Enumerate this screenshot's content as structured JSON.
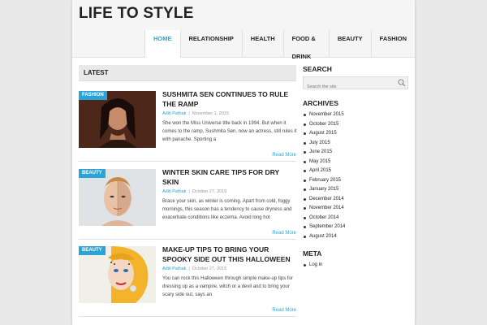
{
  "site": {
    "title": "LIFE TO STYLE"
  },
  "nav": [
    {
      "label": "HOME",
      "active": true
    },
    {
      "label": "RELATIONSHIP"
    },
    {
      "label": "HEALTH"
    },
    {
      "label": "FOOD & DRINK"
    },
    {
      "label": "BEAUTY"
    },
    {
      "label": "FASHION"
    }
  ],
  "main": {
    "section_title": "LATEST",
    "posts": [
      {
        "category": "FASHION",
        "title": "SUSHMITA SEN CONTINUES TO RULE THE RAMP",
        "author": "Aditi Pathak",
        "date": "November 1, 2015",
        "excerpt": "She won the Miss Universe title back in 1994. But when it comes to the ramp, Sushmita Sen, now an actress, still rules it with panache. Sporting a",
        "read_more": "Read More"
      },
      {
        "category": "BEAUTY",
        "title": "WINTER SKIN CARE TIPS FOR DRY SKIN",
        "author": "Aditi Pathak",
        "date": "October 27, 2015",
        "excerpt": "Brace your skin, as winter is coming. Apart from cold, foggy mornings, this season has a tendency to cause dryness and exacerbate conditions like eczema. Avoid long hot",
        "read_more": "Read More"
      },
      {
        "category": "BEAUTY",
        "title": "MAKE-UP TIPS TO BRING YOUR SPOOKY SIDE OUT THIS HALLOWEEN",
        "author": "Aditi Pathak",
        "date": "October 27, 2015",
        "excerpt": "You can rock this Halloween through simple make-up tips for dressing up as a vampire, witch or a devil and to bring your scary side out, says an",
        "read_more": "Read More"
      }
    ]
  },
  "sidebar": {
    "search_title": "SEARCH",
    "search_placeholder": "Search the site",
    "archives_title": "ARCHIVES",
    "archives": [
      "November 2015",
      "October 2015",
      "August 2015",
      "July 2015",
      "June 2015",
      "May 2015",
      "April 2015",
      "February 2015",
      "January 2015",
      "December 2014",
      "November 2014",
      "October 2014",
      "September 2014",
      "August 2014"
    ],
    "meta_title": "META",
    "meta_links": [
      "Log in"
    ]
  },
  "colors": {
    "accent": "#2aa4d6"
  },
  "icons": {
    "search": "search-icon"
  }
}
